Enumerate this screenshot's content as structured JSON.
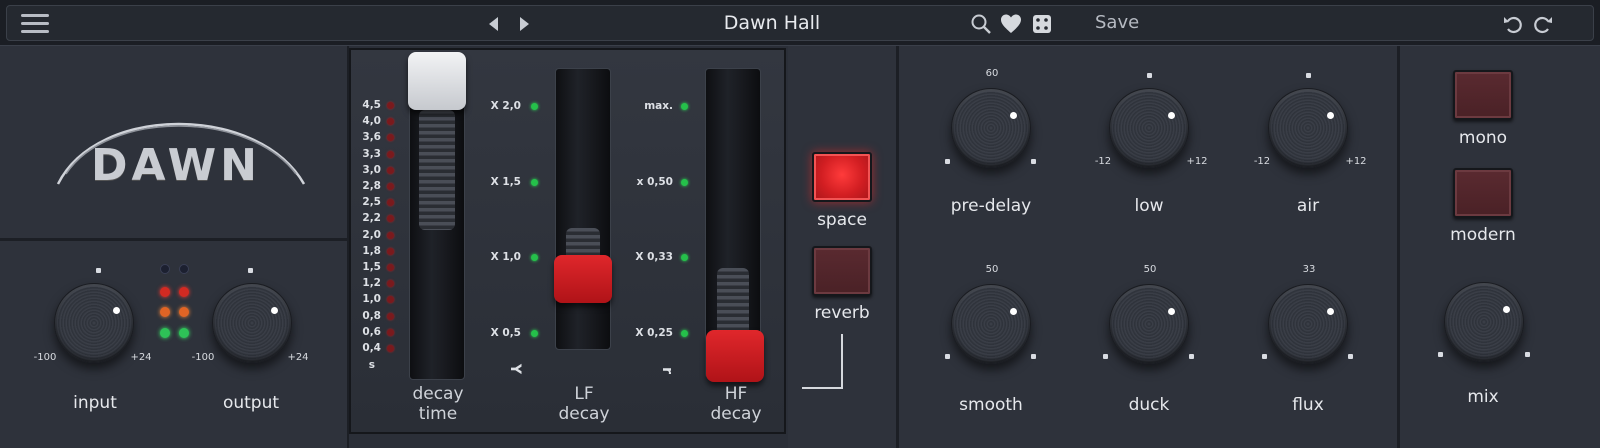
{
  "topbar": {
    "preset_name": "Dawn Hall",
    "save_label": "Save"
  },
  "logo": {
    "text": "DAWN"
  },
  "io": {
    "input": {
      "label": "input",
      "min": "-100",
      "max": "+24"
    },
    "output": {
      "label": "output",
      "min": "-100",
      "max": "+24"
    }
  },
  "decay_meter": {
    "scale": [
      "4,5",
      "4,0",
      "3,6",
      "3,3",
      "3,0",
      "2,8",
      "2,5",
      "2,2",
      "2,0",
      "1,8",
      "1,5",
      "1,2",
      "1,0",
      "0,8",
      "0,6",
      "0,4"
    ],
    "unit": "s"
  },
  "decay_time": {
    "label_line1": "decay",
    "label_line2": "time"
  },
  "lf_decay": {
    "label_line1": "LF",
    "label_line2": "decay",
    "scale": [
      "X 2,0",
      "X 1,5",
      "X 1,0",
      "X 0,5"
    ],
    "symbol": "Y"
  },
  "hf_decay": {
    "label_line1": "HF",
    "label_line2": "decay",
    "scale": [
      "max.",
      "x 0,50",
      "X 0,33",
      "X 0,25"
    ],
    "symbol": "r"
  },
  "mode": {
    "space_label": "space",
    "reverb_label": "reverb"
  },
  "knobs": {
    "pre_delay": {
      "label": "pre-delay",
      "top_value": "60"
    },
    "low": {
      "label": "low",
      "min": "-12",
      "max": "+12"
    },
    "air": {
      "label": "air",
      "min": "-12",
      "max": "+12"
    },
    "smooth": {
      "label": "smooth",
      "top_value": "50"
    },
    "duck": {
      "label": "duck",
      "top_value": "50"
    },
    "flux": {
      "label": "flux",
      "top_value": "33"
    }
  },
  "right": {
    "mono_label": "mono",
    "modern_label": "modern",
    "mix_label": "mix"
  },
  "colors": {
    "accent_red": "#d21e22",
    "background": "#2e323b",
    "led_green": "#25c04a"
  }
}
